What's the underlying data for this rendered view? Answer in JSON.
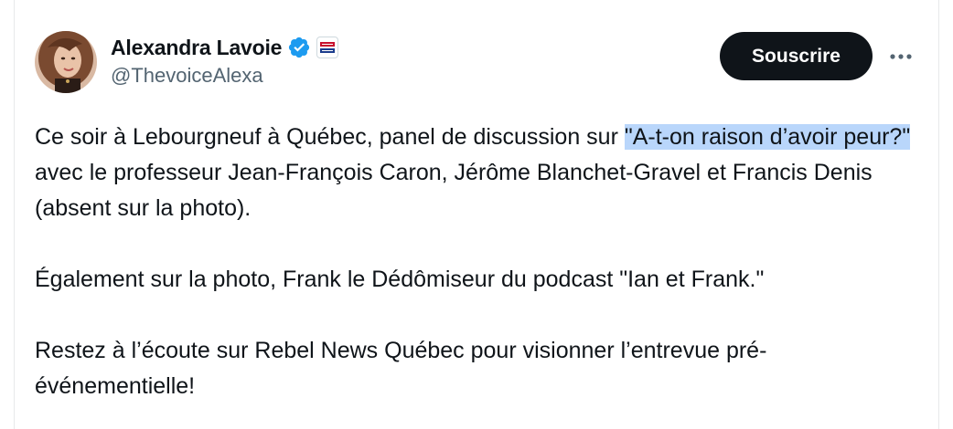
{
  "author": {
    "display_name": "Alexandra Lavoie",
    "handle": "@ThevoiceAlexa",
    "verified_icon": "verified-badge-icon",
    "affiliate_badge": "rebel-news-affiliate-badge",
    "affiliate_badge_text": "REBEL NEWS"
  },
  "actions": {
    "subscribe_label": "Souscrire",
    "more_icon": "more-horizontal-icon"
  },
  "tweet": {
    "p1_before": "Ce soir à Lebourgneuf à Québec, panel de discussion sur ",
    "p1_highlight": "\"A-t-on raison d’avoir peur?\"",
    "p1_after": " avec le professeur Jean-François Caron, Jérôme Blanchet-Gravel et Francis Denis (absent sur la photo).",
    "p2": "Également sur la photo, Frank le Dédômiseur du podcast \"Ian et Frank.\"",
    "p3": "Restez à l’écoute sur Rebel News Québec pour visionner l’entrevue pré-événementielle!"
  },
  "colors": {
    "text": "#0f1419",
    "secondary_text": "#536471",
    "verified": "#1d9bf0",
    "button_bg": "#0f1419",
    "highlight": "#b9d6fb",
    "border": "#e7e9ea"
  }
}
